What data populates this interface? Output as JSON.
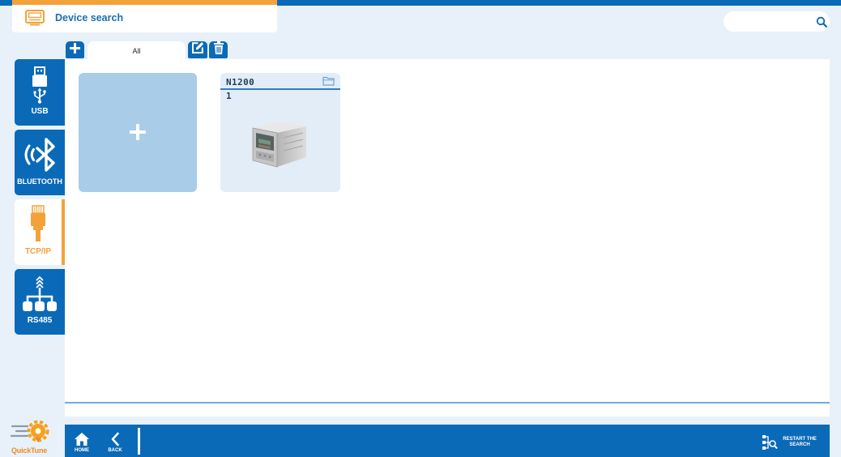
{
  "header": {
    "title": "Device search",
    "icon": "monitor-icon"
  },
  "search": {
    "value": "",
    "icon": "search-icon"
  },
  "tabs": {
    "add_icon": "plus-icon",
    "items": [
      {
        "label": "All",
        "active": true
      }
    ],
    "edit_icon": "edit-icon",
    "delete_icon": "trash-icon"
  },
  "sidebar": {
    "items": [
      {
        "label": "USB",
        "icon": "usb-icon",
        "active": false
      },
      {
        "label": "BLUETOOTH",
        "icon": "bluetooth-icon",
        "active": false
      },
      {
        "label": "TCP/IP",
        "icon": "ethernet-icon",
        "active": true
      },
      {
        "label": "RS485",
        "icon": "rs485-network-icon",
        "active": false
      }
    ]
  },
  "device_grid": {
    "add_card_icon": "plus-icon",
    "devices": [
      {
        "name": "N1200",
        "address": "1",
        "folder_icon": "folder-icon",
        "image": "controller-image"
      }
    ]
  },
  "footer": {
    "home": {
      "label": "HOME",
      "icon": "home-icon"
    },
    "back": {
      "label": "BACK",
      "icon": "chevron-left-icon"
    },
    "restart": {
      "label": "RESTART THE SEARCH",
      "icon": "restart-search-icon"
    }
  },
  "logo": {
    "part1": "Quick",
    "part2": "Tune"
  },
  "colors": {
    "primary": "#0b6ab7",
    "accent": "#f3a23a",
    "background": "#e8f1f9",
    "add_card": "#a9cce9",
    "device_card": "#e2edf7"
  }
}
